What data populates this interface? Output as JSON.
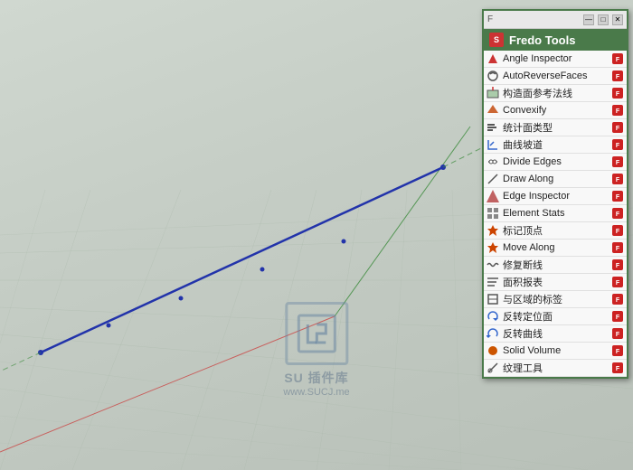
{
  "viewport": {
    "bg_color": "#c8cfc8"
  },
  "panel": {
    "title": "Fredo Tools",
    "titlebar_buttons": [
      "—",
      "□",
      "✕"
    ],
    "items": [
      {
        "id": "angle-inspector",
        "icon": "▲",
        "icon_color": "#cc3333",
        "label": "Angle Inspector",
        "badge": true
      },
      {
        "id": "autoreverse-faces",
        "icon": "⟳",
        "icon_color": "#666",
        "label": "AutoReverseFaces",
        "badge": true
      },
      {
        "id": "construct-refplane",
        "icon": "⊞",
        "icon_color": "#555",
        "label": "构造面参考法线",
        "badge": true
      },
      {
        "id": "convexify",
        "icon": "◆",
        "icon_color": "#cc4400",
        "label": "Convexify",
        "badge": true
      },
      {
        "id": "count-types",
        "icon": "≡",
        "icon_color": "#555",
        "label": "统计面类型",
        "badge": true
      },
      {
        "id": "curve-channel",
        "icon": "↙",
        "icon_color": "#3366cc",
        "label": "曲线坡道",
        "badge": true
      },
      {
        "id": "divide-edges",
        "icon": "✂",
        "icon_color": "#555",
        "label": "Divide Edges",
        "badge": true
      },
      {
        "id": "draw-along",
        "icon": "✏",
        "icon_color": "#555",
        "label": "Draw Along",
        "badge": true
      },
      {
        "id": "edge-inspector",
        "icon": "◢",
        "icon_color": "#aa2222",
        "label": "Edge Inspector",
        "badge": true
      },
      {
        "id": "element-stats",
        "icon": "▦",
        "icon_color": "#555",
        "label": "Element Stats",
        "badge": true
      },
      {
        "id": "mark-vertex",
        "icon": "✦",
        "icon_color": "#cc4400",
        "label": "标记顶点",
        "badge": true
      },
      {
        "id": "move-along",
        "icon": "✦",
        "icon_color": "#cc4400",
        "label": "Move Along",
        "badge": true
      },
      {
        "id": "repair-break",
        "icon": "~",
        "icon_color": "#555",
        "label": "修复断线",
        "badge": true
      },
      {
        "id": "area-report",
        "icon": "≡",
        "icon_color": "#555",
        "label": "面积报表",
        "badge": true
      },
      {
        "id": "region-tag",
        "icon": "⊡",
        "icon_color": "#555",
        "label": "与区域的标签",
        "badge": true
      },
      {
        "id": "reverse-pos",
        "icon": "↺",
        "icon_color": "#3366cc",
        "label": "反转定位面",
        "badge": true
      },
      {
        "id": "reverse-curve",
        "icon": "↺",
        "icon_color": "#3366cc",
        "label": "反转曲线",
        "badge": true
      },
      {
        "id": "solid-volume",
        "icon": "●",
        "icon_color": "#cc4400",
        "label": "Solid Volume",
        "badge": true
      },
      {
        "id": "texture-tool",
        "icon": "⊘",
        "icon_color": "#555",
        "label": "纹理工具",
        "badge": true
      }
    ]
  },
  "watermark": {
    "logo_text": "SU插件库",
    "text1": "SU 插件库",
    "text2": "www.SUCJ.me"
  }
}
